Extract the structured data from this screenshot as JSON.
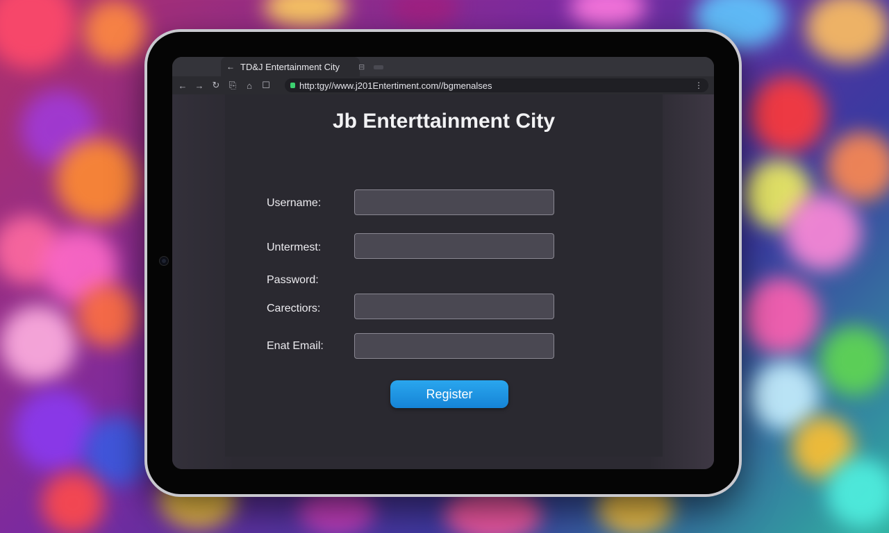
{
  "browser": {
    "tab_title": "TD&J Entertainment City",
    "url": "http:tgy//www.j201Entertiment.com//bgmenalses",
    "colors": {
      "lock": "#3cd070",
      "accent": "#1a96e2"
    }
  },
  "page": {
    "title": "Jb Enterttainment City",
    "form": {
      "username_label": "Username:",
      "field2_label": "Untermest:",
      "password_label": "Password:",
      "field3_label": "Carectiors:",
      "email_label": "Enat Email:",
      "username_value": "",
      "field2_value": "",
      "field3_value": "",
      "email_value": "",
      "register_label": "Register"
    }
  }
}
